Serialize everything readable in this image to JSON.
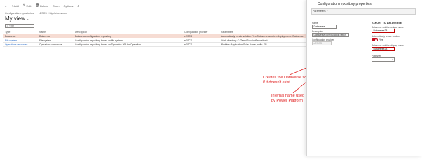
{
  "toolbar": {
    "back_icon": "back-arrow-icon",
    "items": [
      {
        "icon": "+",
        "icon_name": "add-icon",
        "label": "Add"
      },
      {
        "icon": "✎",
        "icon_name": "edit-icon",
        "label": "Edit"
      },
      {
        "icon": "🗑",
        "icon_name": "delete-icon",
        "label": "Delete"
      },
      {
        "icon": "",
        "icon_name": "",
        "label": "Open"
      },
      {
        "icon": "",
        "icon_name": "",
        "label": "Options"
      },
      {
        "icon": "⌕",
        "icon_name": "search-icon",
        "label": ""
      }
    ]
  },
  "breadcrumb": {
    "module": "Configuration repositories",
    "company": "eESCS : http://ebecs.com"
  },
  "page": {
    "title": "My view",
    "title_chevron": "⌄"
  },
  "filter": {
    "placeholder": "Filter",
    "icon": "⌕"
  },
  "grid": {
    "columns": [
      "Type",
      "Name",
      "Description",
      "Configuration provider",
      "Parameters"
    ],
    "rows": [
      [
        "Dataverse",
        "Dataverse",
        "Dataverse configuration repository",
        "eESCS",
        "Automatically create solution: Yes  Dataverse solution display name: Dataverse"
      ],
      [
        "File system",
        "File system",
        "Configuration repository based on file system",
        "eESCS",
        "Work directory: C:\\Temp\\SolutionRepository\\"
      ],
      [
        "Operations resources",
        "Operations resources",
        "Configuration repository based on Dynamics 365 for Operation",
        "eESCS",
        "Modules: Application Suite Name prefix: ER"
      ]
    ],
    "selected_row": 0
  },
  "panel": {
    "title": "Configuration repository properties",
    "section": "Parameters",
    "name_label": "Name",
    "name_value": "Dataverse",
    "description_label": "Description",
    "description_value": "Dataverse configuration repos",
    "provider_label": "Configuration provider",
    "provider_value": "eESCS",
    "export_heading": "EXPORT TO DATAVERSE",
    "unique_name_label": "Dataverse solution unique name",
    "unique_name_value": "Dataverse28",
    "auto_create_label": "Automatically create solution",
    "auto_create_value": "Yes",
    "display_name_label": "Dataverse solution display name",
    "display_name_value": "Dataverse28",
    "publisher_label": "Publisher",
    "publisher_value": ""
  },
  "annotations": {
    "creates_solution": "Creates the Dataverse solution if it doesn't exist",
    "internal_name": "Internal name used by Power Platform"
  },
  "colors": {
    "annotation": "#e02020",
    "selected_row": "#f6dcd3",
    "toggle_on": "#c50f1f",
    "link": "#2266c4"
  }
}
